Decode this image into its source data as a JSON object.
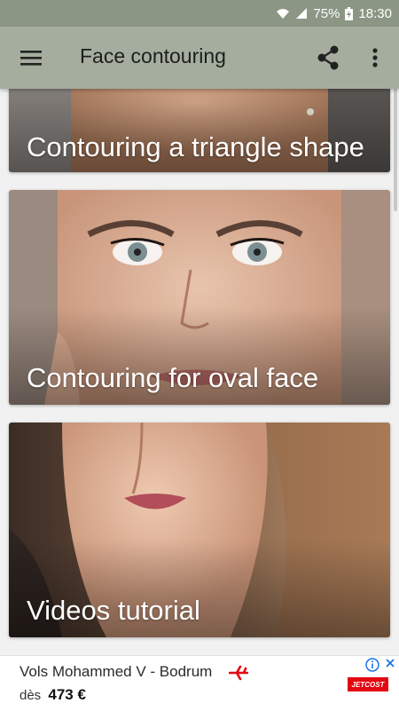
{
  "status_bar": {
    "battery": "75%",
    "time": "18:30",
    "icons": [
      "wifi-icon",
      "signal-icon",
      "battery-icon"
    ]
  },
  "app_bar": {
    "title": "Face contouring",
    "icons": [
      "menu-icon",
      "share-icon",
      "more-vert-icon"
    ]
  },
  "cards": [
    {
      "label": "Contouring a triangle shape"
    },
    {
      "label": "Contouring for oval face"
    },
    {
      "label": "Videos tutorial"
    }
  ],
  "ad": {
    "headline": "Vols Mohammed V - Bodrum",
    "price_prefix": "dès",
    "price": "473 €",
    "brand": "JETCOST",
    "icons": [
      "airplane-icon",
      "info-icon",
      "close-icon"
    ],
    "colors": {
      "brand": "#e30613",
      "accent": "#1a73e8"
    }
  },
  "colors": {
    "status_bar": "#8c9684",
    "app_bar": "#a5ae9e",
    "background": "#f1f1f1"
  }
}
